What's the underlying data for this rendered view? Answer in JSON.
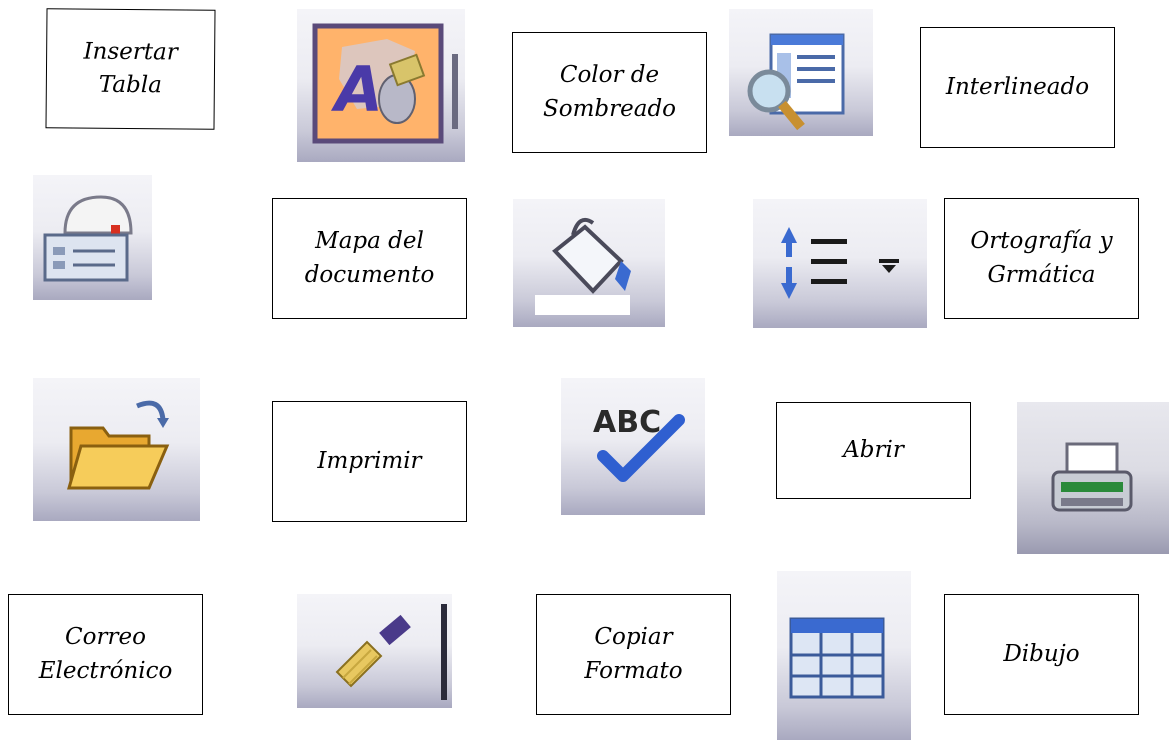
{
  "labels": {
    "insertar_tabla": [
      "Insertar",
      "Tabla"
    ],
    "color_sombreado": [
      "Color de",
      "Sombreado"
    ],
    "interlineado": [
      "Interlineado"
    ],
    "mapa_documento": [
      "Mapa del",
      "documento"
    ],
    "ortografia": [
      "Ortografía y",
      "Grmática"
    ],
    "imprimir": [
      "Imprimir"
    ],
    "abrir": [
      "Abrir"
    ],
    "correo": [
      "Correo",
      "Electrónico"
    ],
    "copiar_formato": [
      "Copiar",
      "Formato"
    ],
    "dibujo": [
      "Dibujo"
    ]
  },
  "icons": {
    "wordart": "wordart-icon",
    "document_map": "document-map-icon",
    "email": "email-icon",
    "shading": "paint-bucket-icon",
    "line_spacing": "line-spacing-icon",
    "open": "open-folder-icon",
    "spelling": "spelling-abc-icon",
    "print": "printer-icon",
    "format_painter": "format-painter-icon",
    "table": "insert-table-icon"
  },
  "colors": {
    "icon_bg_top": "#f4f4f8",
    "icon_bg_bottom": "#a9a9c0",
    "wordart_highlight": "#ffb36b",
    "folder": "#f3c04a",
    "check": "#2f5fd0"
  }
}
